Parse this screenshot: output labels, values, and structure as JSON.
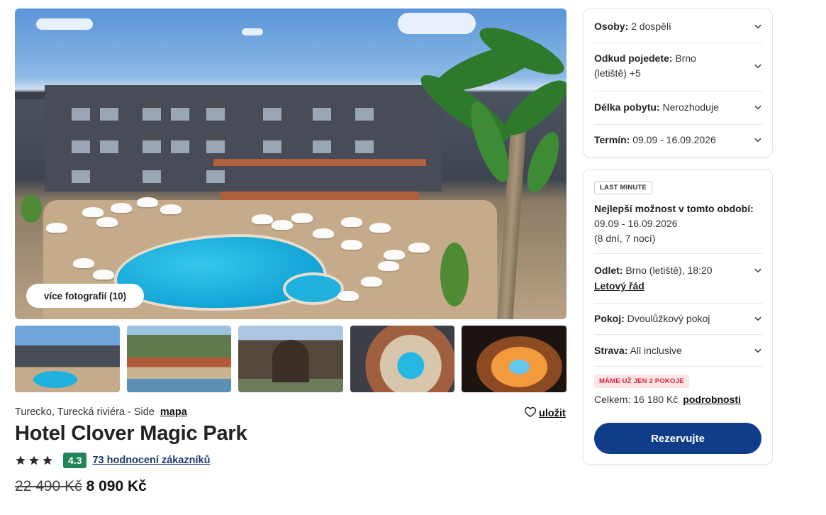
{
  "gallery": {
    "more_photos_label": "více fotografií (10)",
    "thumbnail_count": 5
  },
  "hotel": {
    "location": "Turecko, Turecká riviéra - Side",
    "map_link": "mapa",
    "save_label": "uložit",
    "name": "Hotel Clover Magic Park",
    "stars": 3,
    "rating": "4.3",
    "reviews_link": "73 hodnocení zákazníků",
    "price_old": "22 490 Kč",
    "price_new": "8 090 Kč"
  },
  "search": {
    "persons_label": "Osoby:",
    "persons_value": "2 dospělí",
    "from_label": "Odkud pojedete:",
    "from_value": "Brno",
    "from_value_line2": "(letiště) +5",
    "stay_label": "Délka pobytu:",
    "stay_value": "Nerozhoduje",
    "term_label": "Termín:",
    "term_value": "09.09 - 16.09.2026"
  },
  "offer": {
    "badge": "LAST MINUTE",
    "best_title": "Nejlepší možnost v tomto období:",
    "best_dates": "09.09 - 16.09.2026",
    "best_length": "(8 dní, 7 nocí)",
    "departure_label": "Odlet:",
    "departure_value": "Brno (letiště), 18:20",
    "timetable_link": "Letový řád",
    "room_label": "Pokoj:",
    "room_value": "Dvoulůžkový pokoj",
    "board_label": "Strava:",
    "board_value": "All inclusive",
    "rooms_left_badge": "MÁME UŽ JEN 2 POKOJE",
    "total_label": "Celkem: 16 180 Kč",
    "details_link": "podrobnosti",
    "reserve_button": "Rezervujte"
  },
  "colors": {
    "rating_badge": "#21855a",
    "reserve_button": "#103d8a",
    "rooms_badge_bg": "#fde4e6",
    "rooms_badge_text": "#d3243a"
  },
  "icons": [
    "chevron-down-icon",
    "heart-icon",
    "star-icon"
  ]
}
